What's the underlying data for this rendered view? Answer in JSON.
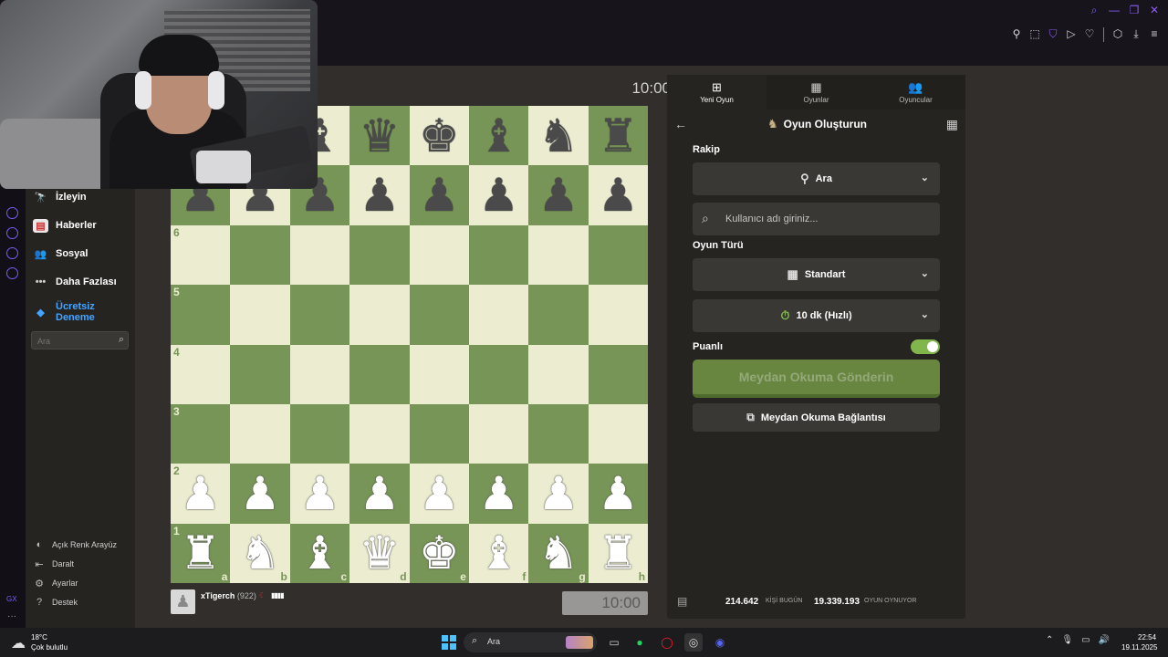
{
  "browser": {
    "window_controls": [
      "search-icon",
      "minimize-icon",
      "restore-icon",
      "close-icon"
    ],
    "toolbar_icons": [
      "pin-icon",
      "screenshot-icon",
      "shield-icon",
      "play-icon",
      "heart-icon",
      "extensions-icon",
      "download-icon",
      "menu-icon"
    ]
  },
  "site_nav": {
    "items": [
      {
        "label": "İzleyin",
        "icon": "binoculars-icon"
      },
      {
        "label": "Haberler",
        "icon": "news-icon"
      },
      {
        "label": "Sosyal",
        "icon": "social-icon"
      },
      {
        "label": "Daha Fazlası",
        "icon": "more-icon"
      },
      {
        "label": "Ücretsiz Deneme",
        "icon": "diamond-icon"
      }
    ],
    "search_placeholder": "Ara",
    "bottom": [
      {
        "label": "Açık Renk Arayüz",
        "icon": "theme-icon"
      },
      {
        "label": "Daralt",
        "icon": "collapse-icon"
      },
      {
        "label": "Ayarlar",
        "icon": "gear-icon"
      },
      {
        "label": "Destek",
        "icon": "help-icon"
      }
    ]
  },
  "game": {
    "opponent_clock": "10:00",
    "player": {
      "name": "xTigerch",
      "rating": "(922)"
    },
    "player_clock": "10:00",
    "ranks": [
      "6",
      "5",
      "4",
      "3",
      "2",
      "1"
    ],
    "files": [
      "a",
      "b",
      "c",
      "d",
      "e",
      "f",
      "g",
      "h"
    ]
  },
  "panel": {
    "tabs": [
      {
        "label": "Yeni Oyun",
        "icon": "plus-icon",
        "active": true
      },
      {
        "label": "Oyunlar",
        "icon": "board-icon",
        "active": false
      },
      {
        "label": "Oyuncular",
        "icon": "players-icon",
        "active": false
      }
    ],
    "title": "Oyun Oluşturun",
    "opponent_label": "Rakip",
    "opponent_value": "Ara",
    "username_placeholder": "Kullanıcı adı giriniz...",
    "game_type_label": "Oyun Türü",
    "game_type_value": "Standart",
    "time_control_value": "10 dk (Hızlı)",
    "rated_label": "Puanlı",
    "rated": true,
    "send_button": "Meydan Okuma Gönderin",
    "link_button": "Meydan Okuma Bağlantısı",
    "stats": {
      "players_today": "214.642",
      "players_today_label": "KİŞİ BUGÜN",
      "playing_now": "19.339.193",
      "playing_now_label": "OYUN OYNUYOR"
    }
  },
  "taskbar": {
    "weather_temp": "18°C",
    "weather_desc": "Çok bulutlu",
    "search_text": "Ara",
    "time": "22:54",
    "date": "19.11.2025"
  },
  "colors": {
    "board_light": "#ebecd0",
    "board_dark": "#779556",
    "accent_green": "#81b64c",
    "gx_purple": "#8a5cf5"
  }
}
